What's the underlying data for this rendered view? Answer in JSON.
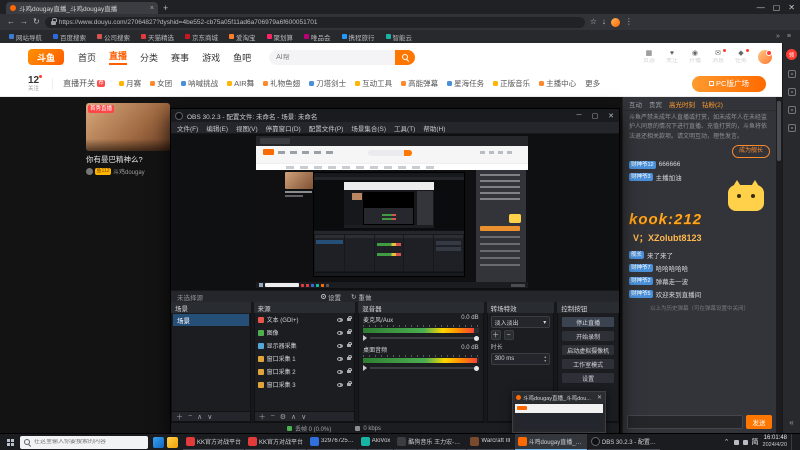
{
  "colors": {
    "accent_orange": "#ff6a00",
    "douyu_red": "#ff4545",
    "obs_selection_blue": "#264f78",
    "meter_green": "#4caf50",
    "promo_orange": "#ffa51e",
    "taskbar_active": "#33363b"
  },
  "browser": {
    "tab_title": "斗鸡dougay直播_斗鸡dougay直播",
    "url": "https://www.douyu.com/27064827?dyshid=4be552-cb75a05f11ad6a706979a6f600051701",
    "bookmarks": [
      "网站导航",
      "百度搜索",
      "公司搜索",
      "天猫精选",
      "京东商城",
      "爱淘宝",
      "聚划算",
      "唯品会",
      "携程旅行",
      "智能云"
    ]
  },
  "douyu": {
    "logo_text": "斗鱼",
    "nav": [
      "首页",
      "直播",
      "分类",
      "赛事",
      "游戏",
      "鱼吧"
    ],
    "search_text": "AI帮",
    "actions": [
      "页游",
      "关注",
      "开播",
      "消息",
      "任务"
    ],
    "subnav": {
      "follow_count": "12",
      "follow_label": "关注",
      "live_switch": "直播开关",
      "rec_badge": "荐",
      "items": [
        "月赛",
        "女团",
        "呐喊挑战",
        "AIR舞",
        "礼物鱼翅",
        "刀塔剑士",
        "互动工具",
        "高能弹幕",
        "星海任务",
        "正版音乐",
        "主播中心",
        "更多"
      ],
      "pc_button": "PC版广场"
    },
    "card": {
      "live_badge": "首秀直播",
      "title": "你有曼巴精神么?",
      "fan_badge": "鱼112",
      "streamer": "斗鸡dougay"
    },
    "chat": {
      "tabs": [
        "互动",
        "贵宾",
        "高光时刻",
        "钻粉(2)"
      ],
      "notice": "斗鱼严禁未成年人直播或打赏，如未成年人在未经监护人同意的情况下进行直播、充值打赏的，斗鱼将依法退还相关款项。请文明互动，理性发言。",
      "join_button": "成为舰长",
      "messages": [
        {
          "badge": "财神爷12",
          "text": "666666"
        },
        {
          "badge": "财神爷3",
          "text": "主播加油"
        },
        {
          "badge": "舰长",
          "text": "来了来了"
        },
        {
          "badge": "财神爷7",
          "text": "哈哈哈哈哈"
        },
        {
          "badge": "财神爷2",
          "text": "弹幕走一波"
        },
        {
          "badge": "财神爷5",
          "text": "欢迎来到直播间"
        }
      ],
      "promo_line1": "kook:212",
      "promo_line2": "V；XZolubt8123",
      "history_hint": "以上为历史弹幕（可在弹幕设置中关闭）",
      "send_button": "发送"
    }
  },
  "obs": {
    "title": "OBS 30.2.3 - 配置文件: 未命名 - 场景: 未命名",
    "menu": [
      "文件(F)",
      "编辑(E)",
      "视图(V)",
      "停靠窗口(D)",
      "配置文件(P)",
      "场景集合(S)",
      "工具(T)",
      "帮助(H)"
    ],
    "source_toolbar_hint": "未选择源",
    "source_toolbar_buttons": [
      "设置",
      "重做"
    ],
    "scenes_dock": {
      "title": "场景",
      "items": [
        "场景"
      ]
    },
    "sources_dock": {
      "title": "来源",
      "items": [
        "文本 (GDI+)",
        "图像",
        "显示器采集",
        "窗口采集 1",
        "窗口采集 2",
        "窗口采集 3"
      ]
    },
    "mixer_dock": {
      "title": "混音器",
      "channels": [
        {
          "name": "麦克风/Aux",
          "db": "0.0 dB",
          "level": 96
        },
        {
          "name": "桌面音频",
          "db": "0.0 dB",
          "level": 99
        }
      ]
    },
    "transitions_dock": {
      "title": "转场特效",
      "current": "淡入淡出",
      "duration_label": "时长",
      "duration_value": "300 ms"
    },
    "controls_dock": {
      "title": "控制按钮",
      "buttons": [
        "停止直播",
        "开始录制",
        "启动虚拟摄像机",
        "工作室模式",
        "设置"
      ]
    },
    "status": {
      "dropped_frames": "丢帧 0 (0.0%)",
      "bitrate": "0 kbps"
    },
    "popup_title": "斗鸡dougay直播_斗鸡dou..."
  },
  "taskbar": {
    "search_placeholder": "在这里输入你要搜索的内容",
    "apps": [
      {
        "label": "KK官方对战平台"
      },
      {
        "label": "KK官方对战平台"
      },
      {
        "label": "32976725…"
      },
      {
        "label": "AloVox"
      },
      {
        "label": "酷狗音乐 王力宏-天·91"
      },
      {
        "label": "Warcraft III"
      },
      {
        "label": "斗鸡dougay直播_斗鸡d…"
      },
      {
        "label": "OBS 30.2.3 - 配置文件:…"
      }
    ],
    "tray": {
      "ime": "简",
      "time": "16:01:48",
      "date": "2024/4/20"
    }
  }
}
